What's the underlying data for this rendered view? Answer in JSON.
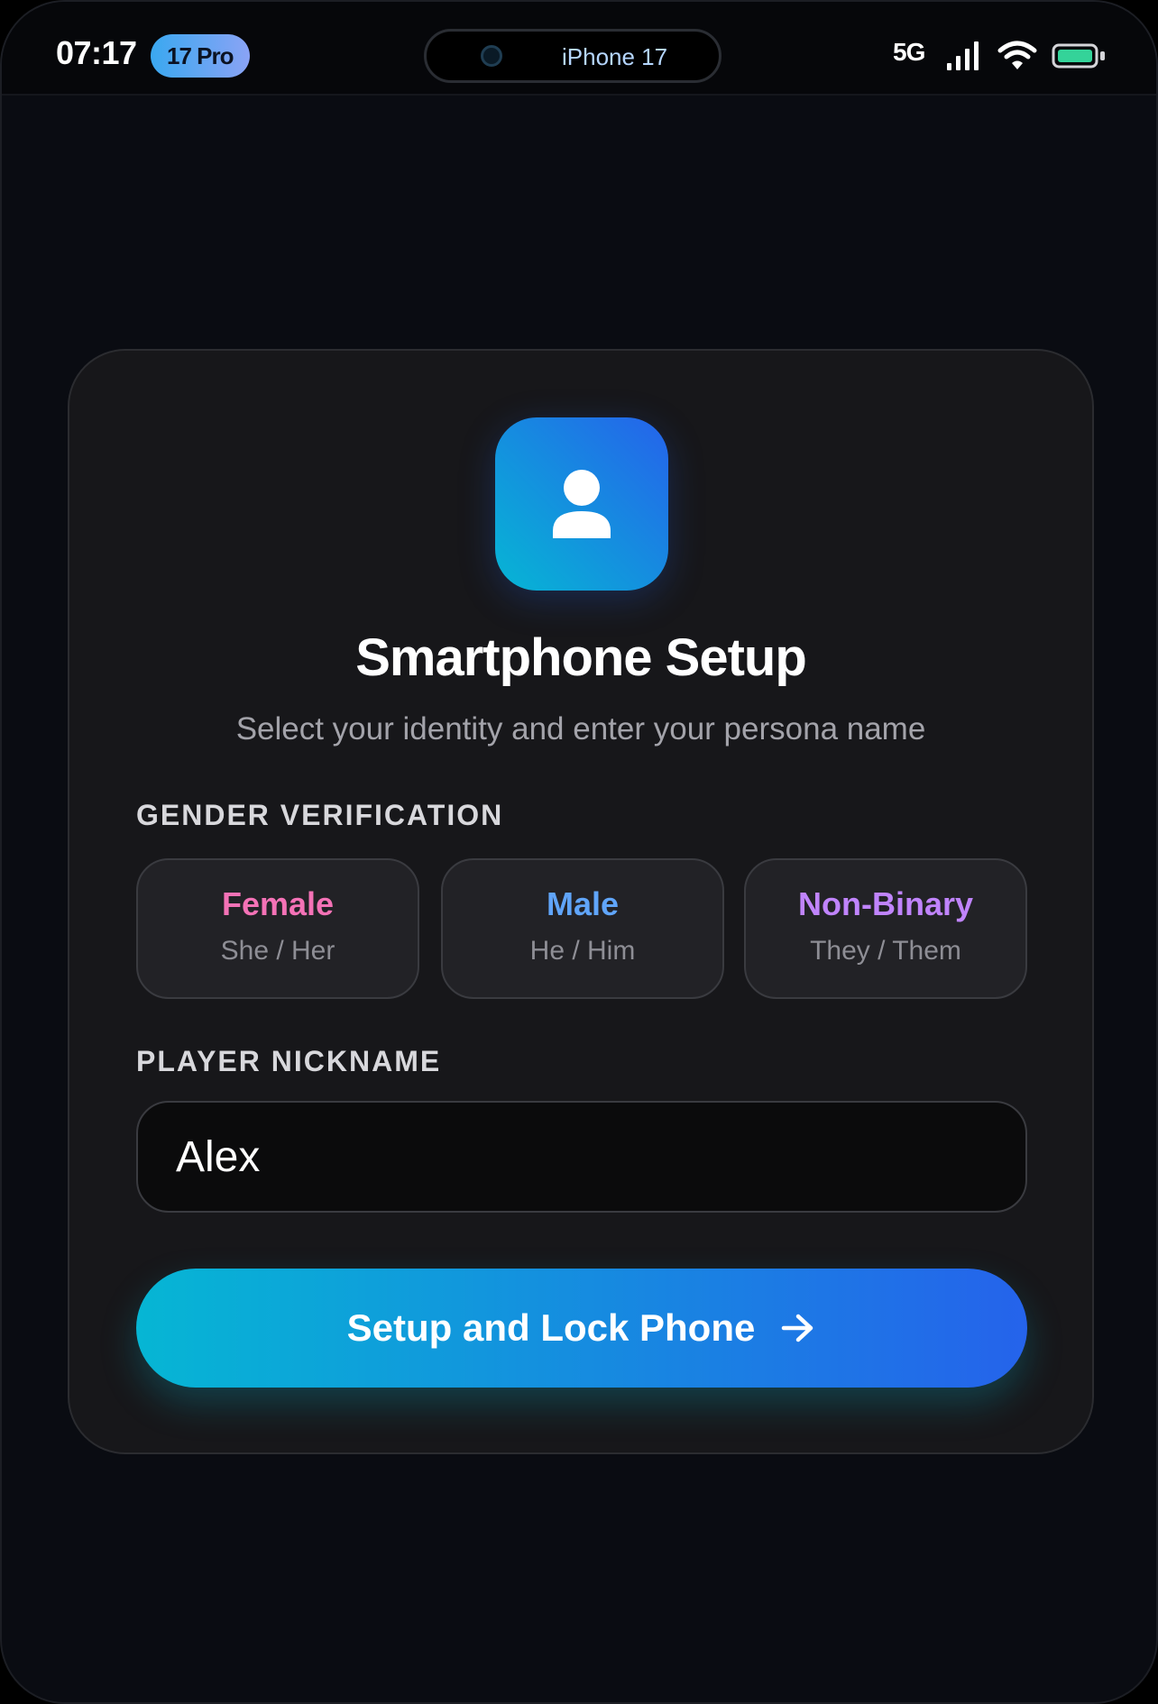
{
  "status_bar": {
    "time": "07:17",
    "model_badge": "17 Pro",
    "island_label": "iPhone 17",
    "network": "5G",
    "battery_color": "#34d399"
  },
  "setup": {
    "icon": "user-icon",
    "title": "Smartphone Setup",
    "subtitle": "Select your identity and enter your persona name",
    "gender_section_label": "GENDER VERIFICATION",
    "gender_options": [
      {
        "name": "Female",
        "pronouns": "She / Her",
        "color": "#f472b6"
      },
      {
        "name": "Male",
        "pronouns": "He / Him",
        "color": "#60a5fa"
      },
      {
        "name": "Non-Binary",
        "pronouns": "They / Them",
        "color": "#c084fc"
      }
    ],
    "nickname_section_label": "PLAYER NICKNAME",
    "nickname_value": "Alex",
    "submit_label": "Setup and Lock Phone",
    "submit_icon": "arrow-right-icon",
    "accent_gradient": [
      "#06b6d4",
      "#2563eb"
    ]
  }
}
